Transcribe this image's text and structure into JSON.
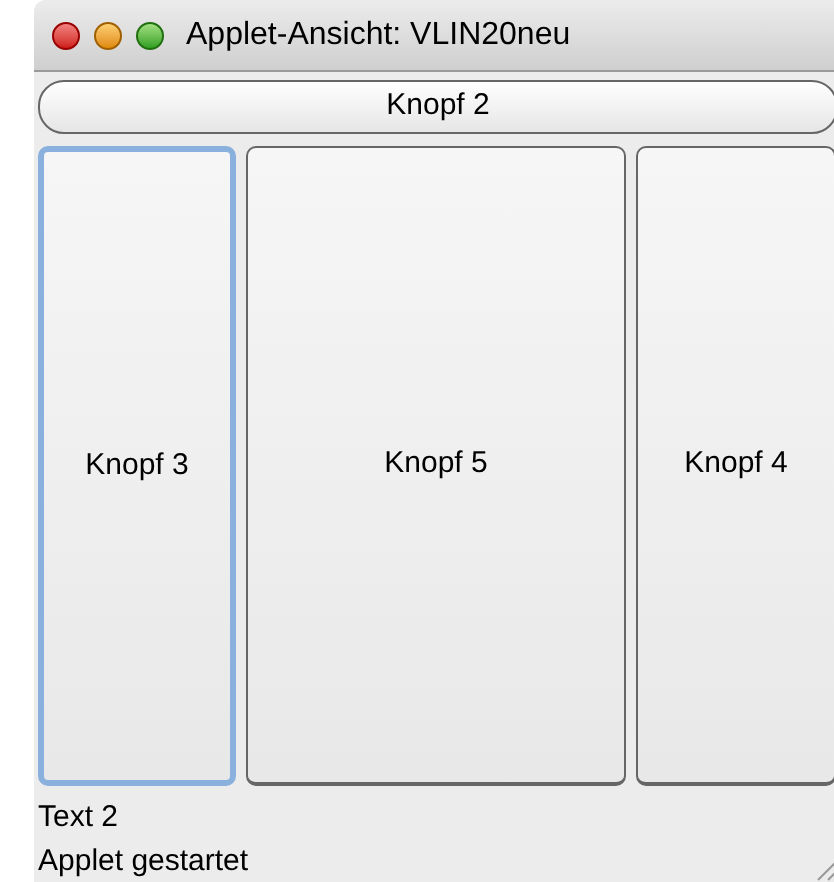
{
  "window": {
    "title": "Applet-Ansicht: VLIN20neu"
  },
  "top_button": {
    "label": "Knopf 2"
  },
  "buttons": [
    {
      "label": "Knopf 3",
      "focused": true
    },
    {
      "label": "Knopf 5",
      "focused": false
    },
    {
      "label": "Knopf 4",
      "focused": false
    }
  ],
  "label": "Text 2",
  "status_bar": "Applet gestartet"
}
